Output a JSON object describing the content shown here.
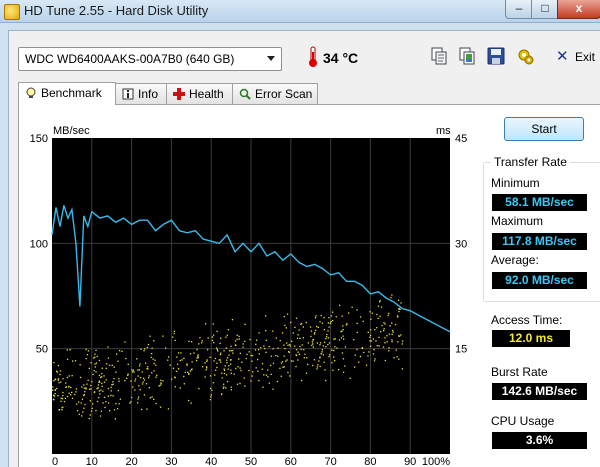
{
  "window": {
    "title": "HD Tune 2.55 - Hard Disk Utility",
    "min": "–",
    "max": "□",
    "close": "x"
  },
  "toolbar": {
    "drive": "WDC WD6400AAKS-00A7B0 (640 GB)",
    "temperature": "34 °C",
    "exit_label": "Exit",
    "icons": [
      "copy-text-icon",
      "copy-screenshot-icon",
      "save-icon",
      "options-icon",
      "exit-icon"
    ]
  },
  "tabs": [
    {
      "label": "Benchmark",
      "icon": "bulb-icon",
      "active": true
    },
    {
      "label": "Info",
      "icon": "info-icon",
      "active": false
    },
    {
      "label": "Health",
      "icon": "health-cross-icon",
      "active": false
    },
    {
      "label": "Error Scan",
      "icon": "magnifier-icon",
      "active": false
    }
  ],
  "side": {
    "start_label": "Start",
    "transfer_rate_title": "Transfer Rate",
    "minimum_label": "Minimum",
    "minimum_value": "58.1 MB/sec",
    "maximum_label": "Maximum",
    "maximum_value": "117.8 MB/sec",
    "average_label": "Average:",
    "average_value": "92.0 MB/sec",
    "access_time_label": "Access Time:",
    "access_time_value": "12.0 ms",
    "burst_rate_label": "Burst Rate",
    "burst_rate_value": "142.6 MB/sec",
    "cpu_usage_label": "CPU Usage",
    "cpu_usage_value": "3.6%"
  },
  "colors": {
    "transfer_line": "#3bb8e8",
    "access_dots": "#e8e23a",
    "plot_bg": "#000000",
    "grid": "#3c3c3c"
  },
  "chart_data": {
    "type": "line",
    "ylabel": "MB/sec",
    "y2label": "ms",
    "y_ticks": [
      "150",
      "100",
      "50"
    ],
    "y2_ticks": [
      "45",
      "30",
      "15"
    ],
    "x_ticks": [
      "0",
      "10",
      "20",
      "30",
      "40",
      "50",
      "60",
      "70",
      "80",
      "90",
      "100%"
    ],
    "ylim": [
      0,
      150
    ],
    "y2lim": [
      0,
      45
    ],
    "xlim": [
      0,
      100
    ],
    "grid": true,
    "series": [
      {
        "name": "Transfer Rate",
        "axis": "left",
        "x": [
          0,
          1,
          2,
          3,
          4,
          5,
          6,
          7,
          8,
          9,
          10,
          12,
          14,
          16,
          18,
          20,
          22,
          24,
          26,
          28,
          30,
          32,
          34,
          36,
          38,
          40,
          42,
          44,
          46,
          48,
          50,
          52,
          54,
          56,
          58,
          60,
          62,
          64,
          66,
          68,
          70,
          72,
          74,
          76,
          78,
          80,
          82,
          84,
          86,
          88,
          90,
          92,
          94,
          96,
          98,
          100
        ],
        "y": [
          104,
          117,
          108,
          118,
          112,
          116,
          100,
          70,
          113,
          108,
          115,
          112,
          113,
          110,
          112,
          109,
          111,
          111,
          106,
          109,
          111,
          106,
          105,
          106,
          102,
          101,
          100,
          104,
          96,
          100,
          96,
          100,
          94,
          96,
          92,
          95,
          91,
          89,
          90,
          88,
          85,
          86,
          82,
          82,
          80,
          76,
          77,
          74,
          72,
          69,
          68,
          66,
          64,
          62,
          60,
          58
        ]
      },
      {
        "name": "Access Time",
        "axis": "right",
        "style": "scatter",
        "description_points": {
          "x": [
            0,
            5,
            10,
            15,
            20,
            25,
            30,
            35,
            40,
            45,
            50,
            55,
            60,
            65,
            70,
            75,
            80,
            85
          ],
          "y_center_ms": [
            9.5,
            10.0,
            10.5,
            11.0,
            11.5,
            12.0,
            12.5,
            13.0,
            13.5,
            14.0,
            14.5,
            15.0,
            15.5,
            16.0,
            16.5,
            17.0,
            17.5,
            18.0
          ],
          "y_spread_ms": 5
        }
      }
    ]
  }
}
